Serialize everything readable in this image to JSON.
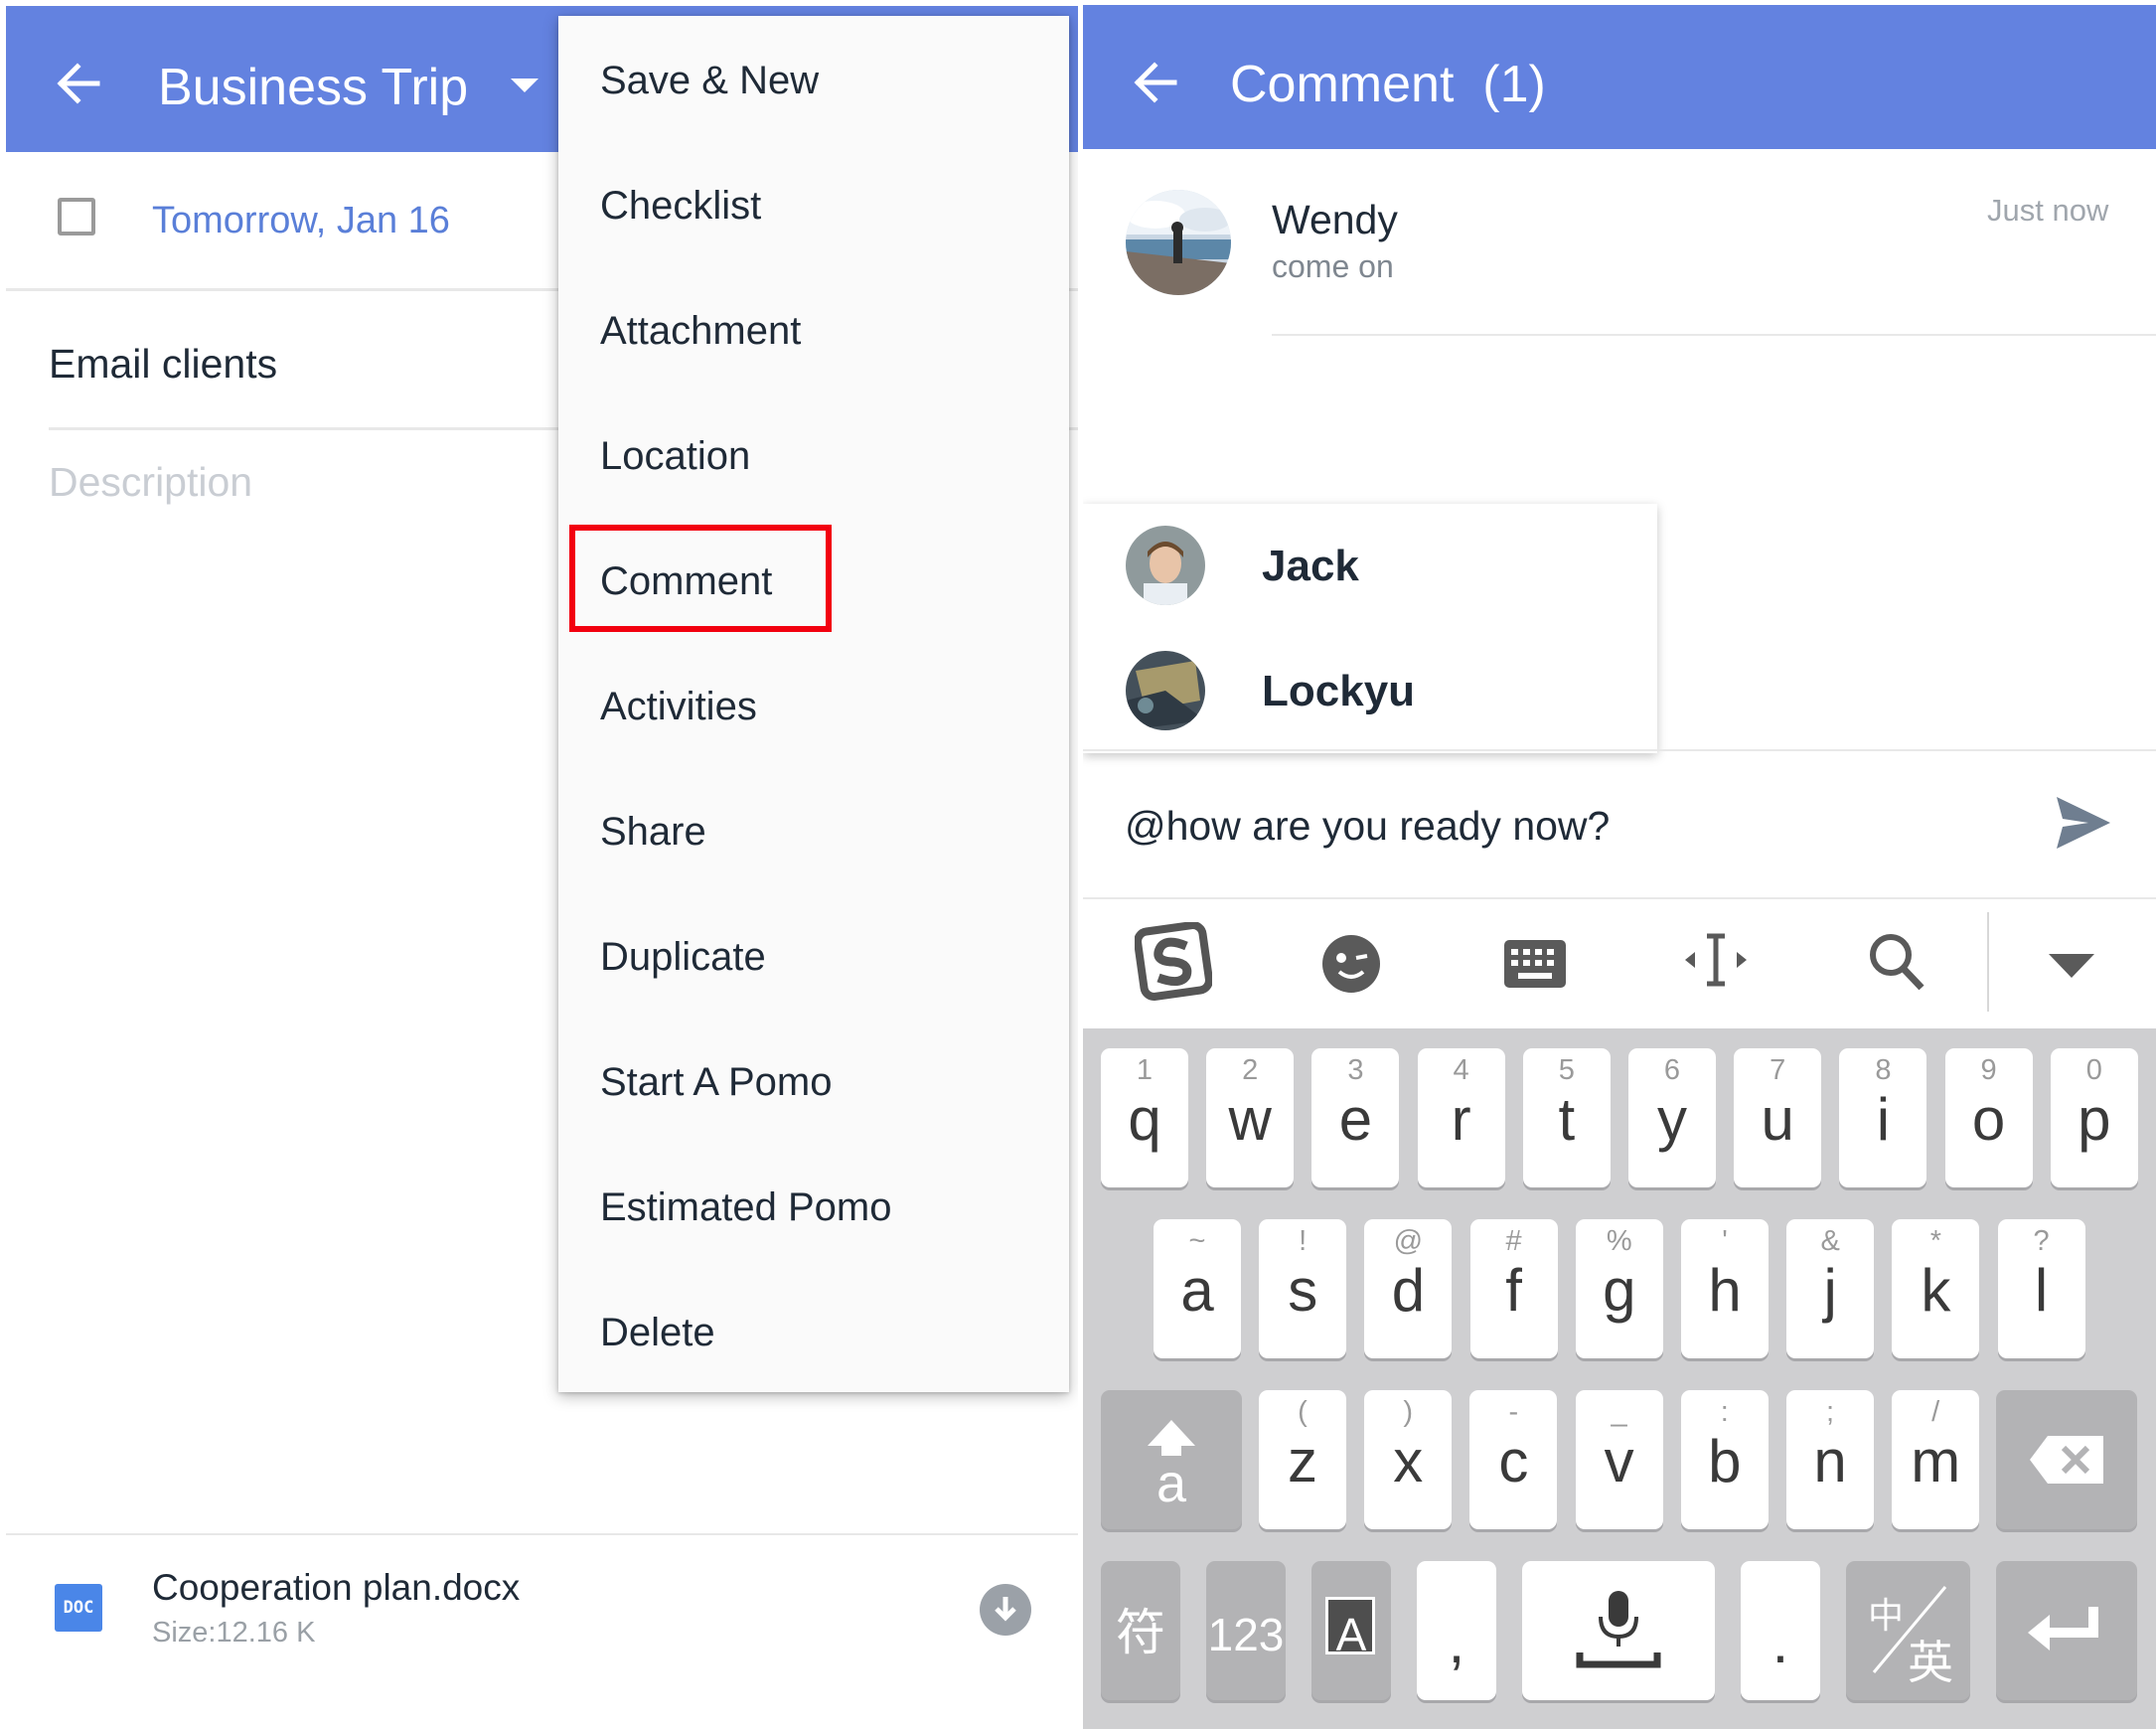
{
  "left": {
    "title": "Business Trip",
    "due_date": "Tomorrow, Jan 16",
    "task_title": "Email clients",
    "description_placeholder": "Description",
    "attachment": {
      "badge": "DOC",
      "name": "Cooperation plan.docx",
      "size": "Size:12.16 K"
    },
    "menu": [
      "Save & New",
      "Checklist",
      "Attachment",
      "Location",
      "Comment",
      "Activities",
      "Share",
      "Duplicate",
      "Start A Pomo",
      "Estimated Pomo",
      "Delete"
    ],
    "highlighted_item": "Comment",
    "highlight_color": "#f2000f"
  },
  "right": {
    "title": "Comment  (1)",
    "comment": {
      "author": "Wendy",
      "text": "come on",
      "time": "Just now"
    },
    "mentions": [
      "Jack",
      "Lockyu"
    ],
    "input_value": "@how are you ready now?",
    "toolbar_icons": [
      "sogou-logo-icon",
      "emoji-icon",
      "keyboard-icon",
      "cursor-move-icon",
      "search-icon",
      "collapse-keyboard-icon"
    ],
    "keyboard": {
      "row1": [
        {
          "k": "q",
          "s": "1"
        },
        {
          "k": "w",
          "s": "2"
        },
        {
          "k": "e",
          "s": "3"
        },
        {
          "k": "r",
          "s": "4"
        },
        {
          "k": "t",
          "s": "5"
        },
        {
          "k": "y",
          "s": "6"
        },
        {
          "k": "u",
          "s": "7"
        },
        {
          "k": "i",
          "s": "8"
        },
        {
          "k": "o",
          "s": "9"
        },
        {
          "k": "p",
          "s": "0"
        }
      ],
      "row2": [
        {
          "k": "a",
          "s": "~"
        },
        {
          "k": "s",
          "s": "!"
        },
        {
          "k": "d",
          "s": "@"
        },
        {
          "k": "f",
          "s": "#"
        },
        {
          "k": "g",
          "s": "%"
        },
        {
          "k": "h",
          "s": "'"
        },
        {
          "k": "j",
          "s": "&"
        },
        {
          "k": "k",
          "s": "*"
        },
        {
          "k": "l",
          "s": "?"
        }
      ],
      "row3": [
        {
          "k": "z",
          "s": "("
        },
        {
          "k": "x",
          "s": ")"
        },
        {
          "k": "c",
          "s": "-"
        },
        {
          "k": "v",
          "s": "_"
        },
        {
          "k": "b",
          "s": ":"
        },
        {
          "k": "n",
          "s": ";"
        },
        {
          "k": "m",
          "s": "/"
        }
      ],
      "shift_label": "a",
      "symbols_label": "符",
      "numbers_label": "123",
      "layout_label": "A",
      "comma_label": ",",
      "period_label": ".",
      "lang_top": "中",
      "lang_bottom": "英"
    }
  },
  "colors": {
    "accent": "#6382e0",
    "date": "#5a7fd8",
    "highlight": "#f2000f"
  }
}
